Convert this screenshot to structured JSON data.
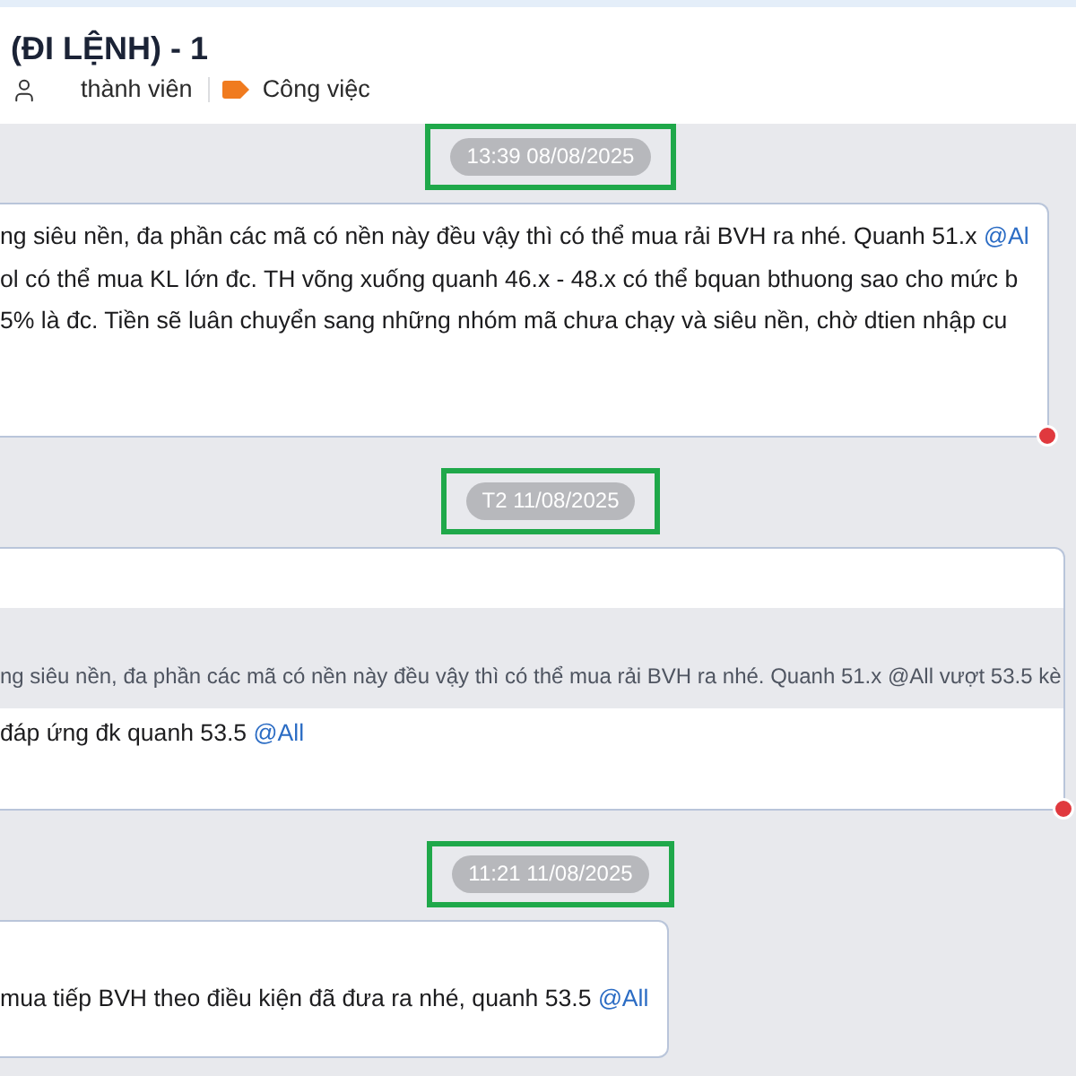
{
  "header": {
    "title": "(ĐI LỆNH) - 1",
    "members_label": "thành viên",
    "tag_label": "Công việc"
  },
  "feed": [
    {
      "kind": "date",
      "label": "13:39 08/08/2025",
      "highlighted": true
    },
    {
      "kind": "message",
      "lines": [
        {
          "text": "ng siêu nền, đa phần các mã có nền này đều vậy thì có thể mua rải BVH ra nhé. Quanh 51.x",
          "mention": "@Al"
        },
        {
          "text": "ol có thể mua KL lớn đc. TH võng xuống quanh 46.x - 48.x có thể bquan bthuong sao cho mức b"
        },
        {
          "text": "5% là đc. Tiền sẽ luân chuyển sang những nhóm mã chưa chạy và siêu nền, chờ dtien nhập cu"
        }
      ],
      "reaction": true
    },
    {
      "kind": "date",
      "label": "T2 11/08/2025",
      "highlighted": true
    },
    {
      "kind": "message",
      "quote": "ng siêu nền, đa phần các mã có nền này đều vậy thì có thể mua rải BVH ra nhé. Quanh 51.x @All vượt 53.5 kè",
      "lines": [
        {
          "text": "đáp ứng đk quanh 53.5",
          "mention": "@All"
        }
      ],
      "reaction": true
    },
    {
      "kind": "date",
      "label": "11:21 11/08/2025",
      "highlighted": true
    },
    {
      "kind": "message",
      "lines": [
        {
          "text": "mua tiếp BVH theo điều kiện đã đưa ra nhé, quanh 53.5",
          "mention": "@All"
        }
      ],
      "reaction": false
    }
  ]
}
